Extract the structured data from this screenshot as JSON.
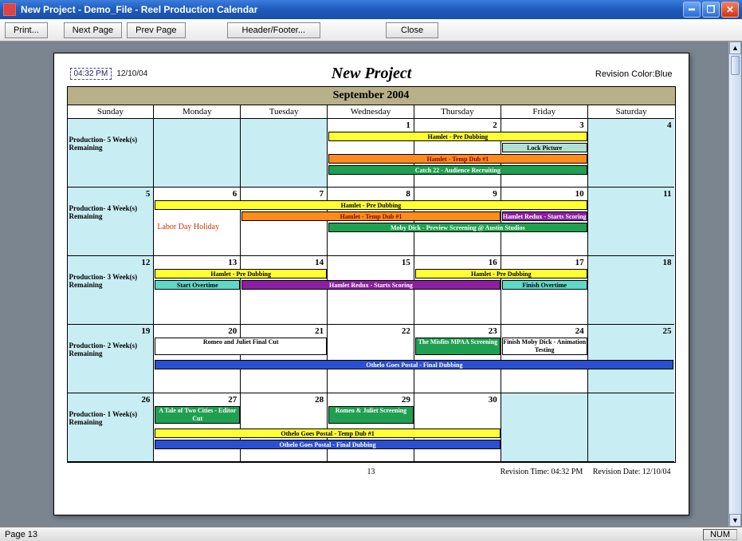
{
  "window": {
    "title": "New Project - Demo_File - Reel Production Calendar"
  },
  "toolbar": {
    "print": "Print...",
    "next": "Next Page",
    "prev": "Prev Page",
    "headerfooter": "Header/Footer...",
    "close": "Close"
  },
  "doc": {
    "time_box": "04:32 PM",
    "date_box": "12/10/04",
    "title": "New Project",
    "revision_color": "Revision Color:Blue"
  },
  "calendar": {
    "month_title": "September 2004",
    "day_headers": [
      "Sunday",
      "Monday",
      "Tuesday",
      "Wednesday",
      "Thursday",
      "Friday",
      "Saturday"
    ],
    "weeks": [
      {
        "label": "Production- 5 Week(s) Remaining",
        "days": [
          "",
          "",
          "",
          "1",
          "2",
          "3",
          "4"
        ],
        "idle": [
          true,
          true,
          true,
          false,
          false,
          false,
          true
        ],
        "holiday": "",
        "bars": [
          {
            "text": "Hamlet - Pre Dubbing",
            "color": "yellow",
            "start": 3,
            "end": 5,
            "row": 0
          },
          {
            "text": "Lock Picture",
            "color": "aqua",
            "start": 5,
            "end": 5,
            "row": 1
          },
          {
            "text": "Hamlet - Temp Dub #1",
            "color": "orange",
            "start": 3,
            "end": 5,
            "row": 2
          },
          {
            "text": "Catch 22 - Audience Recruiting",
            "color": "green",
            "start": 3,
            "end": 5,
            "row": 3
          }
        ]
      },
      {
        "label": "Production- 4 Week(s) Remaining",
        "days": [
          "5",
          "6",
          "7",
          "8",
          "9",
          "10",
          "11"
        ],
        "idle": [
          true,
          false,
          false,
          false,
          false,
          false,
          true
        ],
        "holiday": "Labor Day Holiday",
        "holiday_col": 1,
        "bars": [
          {
            "text": "Hamlet - Pre Dubbing",
            "color": "yellow",
            "start": 1,
            "end": 5,
            "row": 0
          },
          {
            "text": "Hamlet - Temp Dub #1",
            "color": "orange",
            "start": 2,
            "end": 4,
            "row": 1
          },
          {
            "text": "Hamlet Redux - Starts Scoring",
            "color": "purple",
            "start": 5,
            "end": 5,
            "row": 1
          },
          {
            "text": "Moby Dick - Preview Screening @ Austin Studios",
            "color": "green",
            "start": 3,
            "end": 5,
            "row": 2
          }
        ]
      },
      {
        "label": "Production- 3 Week(s) Remaining",
        "days": [
          "12",
          "13",
          "14",
          "15",
          "16",
          "17",
          "18"
        ],
        "idle": [
          true,
          false,
          false,
          false,
          false,
          false,
          true
        ],
        "holiday": "",
        "bars": [
          {
            "text": "Hamlet - Pre Dubbing",
            "color": "yellow",
            "start": 1,
            "end": 2,
            "row": 0
          },
          {
            "text": "Hamlet - Pre Dubbing",
            "color": "yellow",
            "start": 4,
            "end": 5,
            "row": 0
          },
          {
            "text": "Start Overtime",
            "color": "cyan",
            "start": 1,
            "end": 1,
            "row": 1
          },
          {
            "text": "Hamlet Redux - Starts Scoring",
            "color": "purple",
            "start": 2,
            "end": 4,
            "row": 1
          },
          {
            "text": "Finish Overtime",
            "color": "cyan",
            "start": 5,
            "end": 5,
            "row": 1
          }
        ]
      },
      {
        "label": "Production- 2 Week(s) Remaining",
        "days": [
          "19",
          "20",
          "21",
          "22",
          "23",
          "24",
          "25"
        ],
        "idle": [
          true,
          false,
          false,
          false,
          false,
          false,
          true
        ],
        "holiday": "",
        "bars": [
          {
            "text": "Romeo and Juliet Final Cut",
            "color": "white",
            "start": 1,
            "end": 2,
            "row": 0
          },
          {
            "text": "The Misfits MPAA Screening",
            "color": "green",
            "start": 4,
            "end": 4,
            "row": 0
          },
          {
            "text": "Finish Moby Dick - Animation Testing",
            "color": "white",
            "start": 5,
            "end": 5,
            "row": 0
          },
          {
            "text": "Othelo Goes Postal - Final Dubbing",
            "color": "blue",
            "start": 1,
            "end": 6,
            "row": 2
          }
        ]
      },
      {
        "label": "Production- 1 Week(s) Remaining",
        "days": [
          "26",
          "27",
          "28",
          "29",
          "30",
          "",
          ""
        ],
        "idle": [
          true,
          false,
          false,
          false,
          false,
          true,
          true
        ],
        "holiday": "",
        "bars": [
          {
            "text": "A Tale of Two Cities - Editor Cut",
            "color": "green",
            "start": 1,
            "end": 1,
            "row": 0
          },
          {
            "text": "Romeo & Juliet Screening",
            "color": "green",
            "start": 3,
            "end": 3,
            "row": 0
          },
          {
            "text": "Othelo Goes Postal - Temp Dub #1",
            "color": "yellow",
            "start": 1,
            "end": 4,
            "row": 2
          },
          {
            "text": "Othelo Goes Postal - Final Dubbing",
            "color": "blue",
            "start": 1,
            "end": 4,
            "row": 3
          }
        ]
      }
    ]
  },
  "footer": {
    "page_number": "13",
    "revision_time": "Revision Time: 04:32 PM",
    "revision_date": "Revision Date: 12/10/04"
  },
  "status": {
    "page": "Page 13",
    "num": "NUM"
  }
}
